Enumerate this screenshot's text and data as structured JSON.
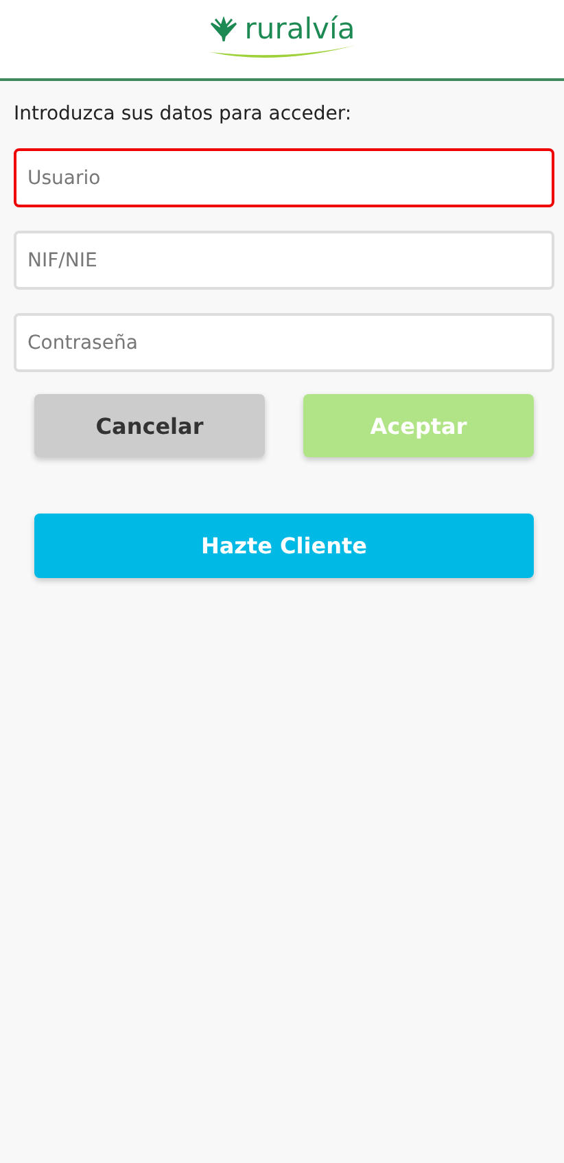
{
  "header": {
    "logo_text": "ruralvía"
  },
  "instructions": "Introduzca sus datos para acceder:",
  "fields": [
    {
      "placeholder": "Usuario",
      "error": true
    },
    {
      "placeholder": "NIF/NIE",
      "error": false
    },
    {
      "placeholder": "Contraseña",
      "error": false
    }
  ],
  "buttons": [
    {
      "kind": "cancel",
      "label": "Cancelar",
      "disabled": false
    },
    {
      "kind": "accept",
      "label": "Aceptar",
      "disabled": true
    }
  ],
  "signup_button": {
    "label": "Hazte Cliente"
  }
}
